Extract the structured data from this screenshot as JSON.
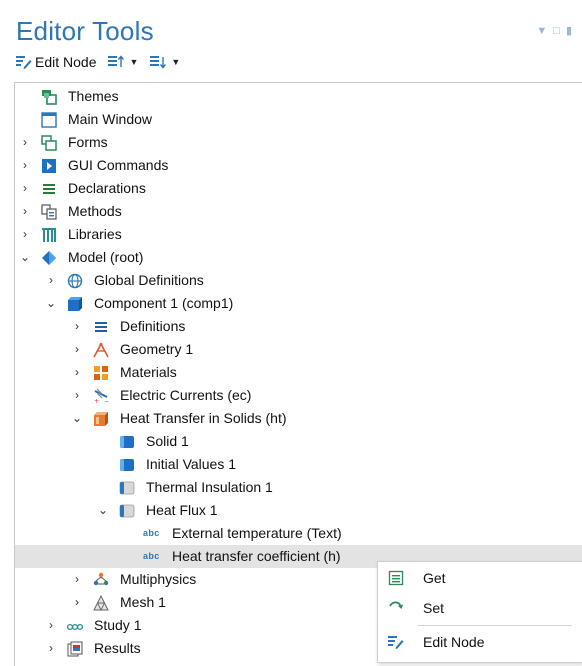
{
  "window": {
    "title": "Editor Tools"
  },
  "toolbar": {
    "edit_node_label": "Edit Node"
  },
  "tree": {
    "items": [
      {
        "label": "Themes"
      },
      {
        "label": "Main Window"
      },
      {
        "label": "Forms"
      },
      {
        "label": "GUI Commands"
      },
      {
        "label": "Declarations"
      },
      {
        "label": "Methods"
      },
      {
        "label": "Libraries"
      },
      {
        "label": "Model (root)"
      },
      {
        "label": "Global Definitions"
      },
      {
        "label": "Component 1 (comp1)"
      },
      {
        "label": "Definitions"
      },
      {
        "label": "Geometry 1"
      },
      {
        "label": "Materials"
      },
      {
        "label": "Electric Currents (ec)"
      },
      {
        "label": "Heat Transfer in Solids (ht)"
      },
      {
        "label": "Solid 1"
      },
      {
        "label": "Initial Values 1"
      },
      {
        "label": "Thermal Insulation 1"
      },
      {
        "label": "Heat Flux 1"
      },
      {
        "label": "External temperature (Text)",
        "tag": "abc"
      },
      {
        "label": "Heat transfer coefficient (h)",
        "tag": "abc"
      },
      {
        "label": "Multiphysics"
      },
      {
        "label": "Mesh 1"
      },
      {
        "label": "Study 1"
      },
      {
        "label": "Results"
      }
    ]
  },
  "context_menu": {
    "items": [
      {
        "label": "Get"
      },
      {
        "label": "Set"
      },
      {
        "label": "Edit Node"
      }
    ]
  },
  "colors": {
    "accent": "#2e76b7",
    "selection": "#e3e3e3"
  }
}
